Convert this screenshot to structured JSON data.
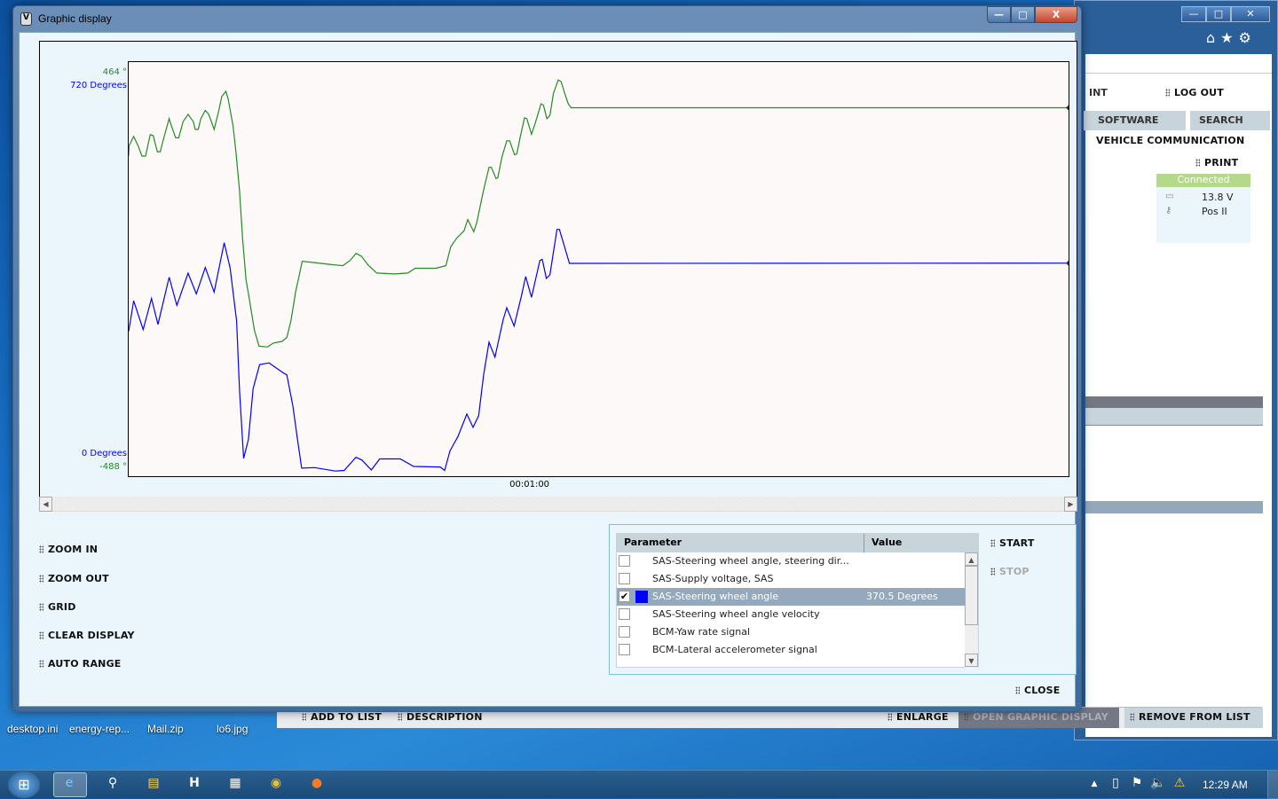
{
  "dialog": {
    "title": "Graphic display",
    "window_controls": {
      "minimize": "—",
      "maximize": "□",
      "close": "X"
    }
  },
  "chart_data": {
    "type": "line",
    "x_tick_labels": [
      "00:01:00"
    ],
    "x_ticks": [
      60
    ],
    "xlim": [
      0,
      140.7
    ],
    "grid": false,
    "series": [
      {
        "color": "#228b22",
        "axis_top_label": "464 °",
        "axis_bottom_label": "-488 °",
        "ylim": [
          -488,
          464
        ],
        "x": [
          0,
          0.04,
          0.75,
          1.37,
          1.99,
          2.52,
          3.23,
          3.67,
          4.29,
          4.73,
          5.26,
          6.06,
          6.41,
          7.03,
          7.48,
          8.14,
          8.89,
          9.69,
          9.96,
          10.4,
          10.8,
          11.46,
          11.99,
          12.79,
          13.5,
          13.94,
          14.56,
          14.91,
          15.62,
          16.06,
          16.59,
          17.04,
          17.57,
          18.1,
          18.81,
          19.52,
          20.76,
          21.64,
          22.97,
          23.67,
          24.29,
          25,
          25.53,
          25.98,
          27.83,
          30.05,
          32.04,
          33.15,
          34.03,
          34.83,
          35.8,
          37.13,
          39.79,
          41.78,
          42.89,
          45.99,
          47.49,
          48.2,
          49.08,
          50.19,
          50.77,
          51.65,
          52.1,
          53.14,
          53.94,
          54.29,
          55,
          55.26,
          55.88,
          56.6,
          57.04,
          57.75,
          58.1,
          58.63,
          59.25,
          59.6,
          60.31,
          60.93,
          61.73,
          62.08,
          62.61,
          63.06,
          63.59,
          64.3,
          64.74,
          65.27,
          65.8,
          66.24,
          140.7
        ],
        "y": [
          249,
          271,
          293,
          273,
          248,
          248,
          297,
          295,
          258,
          258,
          290,
          334,
          317,
          290,
          290,
          327,
          344,
          327,
          309,
          309,
          334,
          353,
          344,
          309,
          353,
          385,
          397,
          378,
          317,
          256,
          168,
          59,
          -36,
          -84,
          -152,
          -189,
          -191,
          -182,
          -178,
          -169,
          -131,
          -63,
          -26,
          6,
          3,
          -1,
          -4,
          8,
          24,
          18,
          -2,
          -21,
          -23,
          -21,
          -10,
          -10,
          -4,
          39,
          59,
          76,
          102,
          74,
          94,
          171,
          222,
          222,
          196,
          198,
          246,
          283,
          283,
          251,
          253,
          293,
          336,
          334,
          298,
          327,
          368,
          365,
          334,
          341,
          392,
          423,
          419,
          392,
          368,
          359,
          359
        ]
      },
      {
        "color": "#0000ff",
        "axis_top_label": "720 Degrees",
        "axis_bottom_label": "0 Degrees",
        "ylim": [
          0,
          720
        ],
        "x": [
          0,
          0.75,
          2.17,
          3.41,
          4.38,
          6.06,
          7.21,
          8.89,
          10.13,
          11.46,
          12.79,
          14.29,
          15.18,
          16.15,
          16.59,
          17.21,
          17.92,
          18.63,
          19.6,
          21.02,
          22.97,
          23.67,
          24.56,
          25.27,
          25.89,
          27.83,
          30.93,
          32.26,
          34.03,
          34.91,
          36.33,
          37.57,
          40.67,
          42.66,
          46.64,
          47.3,
          48.1,
          49.29,
          50.62,
          51.55,
          52.39,
          53.14,
          53.94,
          54.83,
          56.06,
          56.6,
          57.7,
          58.81,
          59.43,
          60.31,
          61.55,
          61.91,
          62.52,
          63.06,
          64.12,
          64.48,
          65.27,
          65.98,
          140.7
        ],
        "y": [
          252,
          305,
          255,
          309,
          264,
          346,
          297,
          353,
          317,
          363,
          320,
          406,
          362,
          270,
          149,
          31,
          64,
          152,
          194,
          197,
          181,
          176,
          123,
          64,
          14,
          15,
          9,
          10,
          33,
          28,
          11,
          30,
          30,
          17,
          16,
          10,
          44,
          69,
          108,
          85,
          105,
          177,
          233,
          207,
          272,
          293,
          261,
          314,
          347,
          311,
          375,
          377,
          344,
          350,
          429,
          429,
          398,
          370,
          370.5
        ]
      }
    ]
  },
  "controls": [
    "ZOOM IN",
    "ZOOM OUT",
    "GRID",
    "CLEAR DISPLAY",
    "AUTO RANGE"
  ],
  "param_table": {
    "headers": [
      "Parameter",
      "Value"
    ],
    "rows": [
      {
        "checked": false,
        "name": "SAS-Steering wheel angle, steering dir...",
        "value": "",
        "color": ""
      },
      {
        "checked": false,
        "name": "SAS-Supply voltage, SAS",
        "value": "",
        "color": ""
      },
      {
        "checked": true,
        "name": "SAS-Steering wheel angle",
        "value": "370.5 Degrees",
        "color": "#0000ff",
        "selected": true
      },
      {
        "checked": false,
        "name": "SAS-Steering wheel angle velocity",
        "value": "",
        "color": ""
      },
      {
        "checked": false,
        "name": "BCM-Yaw rate signal",
        "value": "",
        "color": ""
      },
      {
        "checked": false,
        "name": "BCM-Lateral accelerometer signal",
        "value": "",
        "color": ""
      }
    ]
  },
  "actions": {
    "start": "START",
    "stop": "STOP",
    "close": "CLOSE"
  },
  "bg_app": {
    "user_fragment": "INT",
    "logout": "LOG OUT",
    "tabs": [
      "SOFTWARE",
      "SEARCH"
    ],
    "section": "VEHICLE COMMUNICATION",
    "print": "PRINT",
    "status": "Connected",
    "voltage": "13.8 V",
    "ignition": "Pos II",
    "bottom_buttons": [
      "ADD TO LIST",
      "DESCRIPTION",
      "ENLARGE",
      "OPEN GRAPHIC DISPLAY",
      "REMOVE FROM LIST"
    ]
  },
  "desktop_icons": [
    "desktop.ini",
    "energy-rep...",
    "Mail.zip",
    "lo6.jpg"
  ],
  "taskbar": {
    "clock": "12:29 AM"
  }
}
